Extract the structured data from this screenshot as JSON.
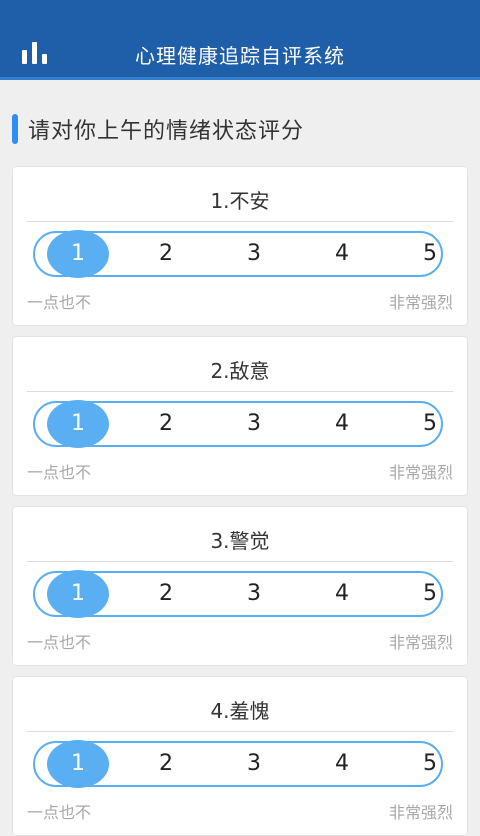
{
  "header": {
    "title": "心理健康追踪自评系统",
    "icon": "bar-chart-icon"
  },
  "section": {
    "title": "请对你上午的情绪状态评分"
  },
  "scale_labels": {
    "low": "一点也不",
    "high": "非常强烈"
  },
  "colors": {
    "header": "#1f5ea8",
    "accent": "#5aaef2"
  },
  "questions": [
    {
      "title": "1.不安",
      "options": [
        "1",
        "2",
        "3",
        "4",
        "5"
      ],
      "selected": "1"
    },
    {
      "title": "2.敌意",
      "options": [
        "1",
        "2",
        "3",
        "4",
        "5"
      ],
      "selected": "1"
    },
    {
      "title": "3.警觉",
      "options": [
        "1",
        "2",
        "3",
        "4",
        "5"
      ],
      "selected": "1"
    },
    {
      "title": "4.羞愧",
      "options": [
        "1",
        "2",
        "3",
        "4",
        "5"
      ],
      "selected": "1"
    }
  ]
}
